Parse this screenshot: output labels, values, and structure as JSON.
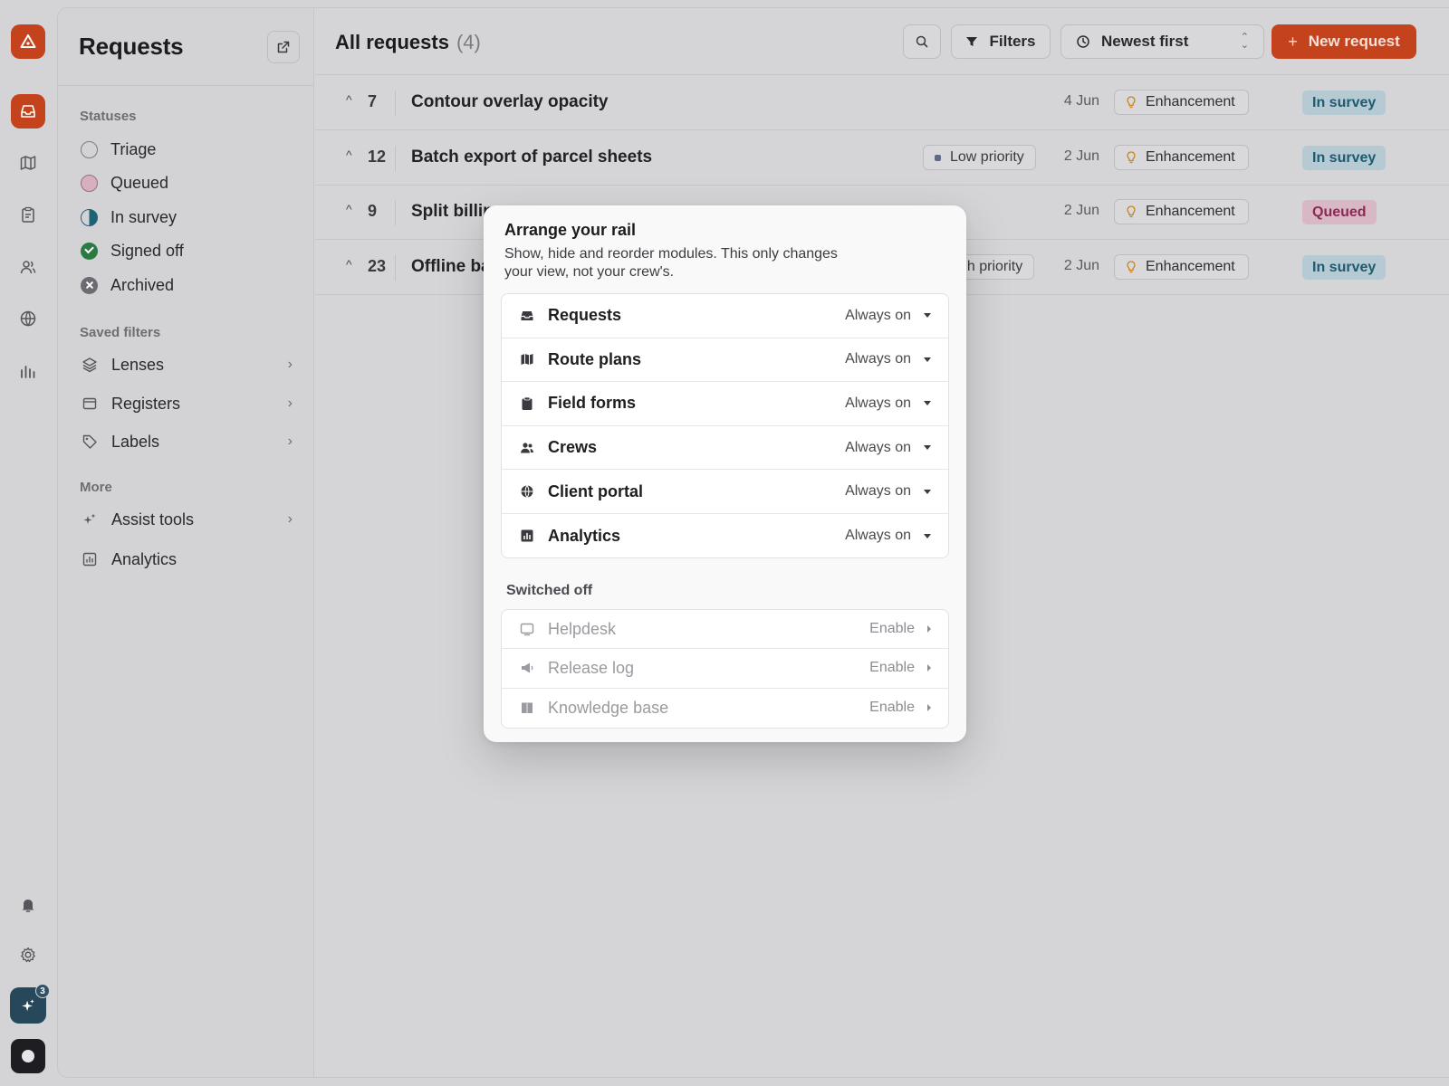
{
  "sidebar": {
    "title": "Requests",
    "sections": {
      "statuses": "Statuses",
      "saved_filters": "Saved filters",
      "more": "More"
    },
    "statuses": [
      {
        "label": "Triage"
      },
      {
        "label": "Queued"
      },
      {
        "label": "In survey"
      },
      {
        "label": "Signed off"
      },
      {
        "label": "Archived"
      }
    ],
    "saved_filters": [
      {
        "label": "Lenses",
        "icon": "layers-icon"
      },
      {
        "label": "Registers",
        "icon": "window-icon"
      },
      {
        "label": "Labels",
        "icon": "tag-icon"
      }
    ],
    "more": [
      {
        "label": "Assist tools",
        "icon": "sparkle-icon"
      },
      {
        "label": "Analytics",
        "icon": "chart-icon"
      }
    ]
  },
  "rail": {
    "assist_badge": "3",
    "items": [
      "inbox-icon",
      "map-icon",
      "clipboard-icon",
      "users-icon",
      "globe-icon",
      "bar-chart-icon",
      "bell-icon",
      "gear-icon"
    ]
  },
  "header": {
    "title": "All requests",
    "count": "(4)",
    "filters_label": "Filters",
    "sort_label": "Newest first",
    "new_label": "New request"
  },
  "requests": [
    {
      "num": "7",
      "title": "Contour overlay opacity",
      "priority": "",
      "date": "4 Jun",
      "label": "Enhancement",
      "status": "In survey"
    },
    {
      "num": "12",
      "title": "Batch export of parcel sheets",
      "priority": "Low priority",
      "date": "2 Jun",
      "label": "Enhancement",
      "status": "In survey"
    },
    {
      "num": "9",
      "title": "Split billin",
      "priority": "",
      "date": "2 Jun",
      "label": "Enhancement",
      "status": "Queued"
    },
    {
      "num": "23",
      "title": "Offline ba",
      "priority": "gh priority",
      "date": "2 Jun",
      "label": "Enhancement",
      "status": "In survey"
    }
  ],
  "popover": {
    "title": "Arrange your rail",
    "description": "Show, hide and reorder modules. This only changes your view, not your crew's.",
    "switched_off_label": "Switched off",
    "enabled_modules": [
      {
        "name": "Requests",
        "state": "Always on",
        "icon": "inbox-icon"
      },
      {
        "name": "Route plans",
        "state": "Always on",
        "icon": "map-icon"
      },
      {
        "name": "Field forms",
        "state": "Always on",
        "icon": "clipboard-icon"
      },
      {
        "name": "Crews",
        "state": "Always on",
        "icon": "users-icon"
      },
      {
        "name": "Client portal",
        "state": "Always on",
        "icon": "globe-icon"
      },
      {
        "name": "Analytics",
        "state": "Always on",
        "icon": "bar-chart-icon"
      }
    ],
    "disabled_modules": [
      {
        "name": "Helpdesk",
        "state": "Enable",
        "icon": "monitor-icon"
      },
      {
        "name": "Release log",
        "state": "Enable",
        "icon": "megaphone-icon"
      },
      {
        "name": "Knowledge base",
        "state": "Enable",
        "icon": "book-icon"
      }
    ]
  },
  "colors": {
    "accent": "#c4431c",
    "survey_bg": "#b6cad3",
    "survey_fg": "#1e5a70",
    "queued_bg": "#d8b8c4",
    "queued_fg": "#8a2a52"
  }
}
